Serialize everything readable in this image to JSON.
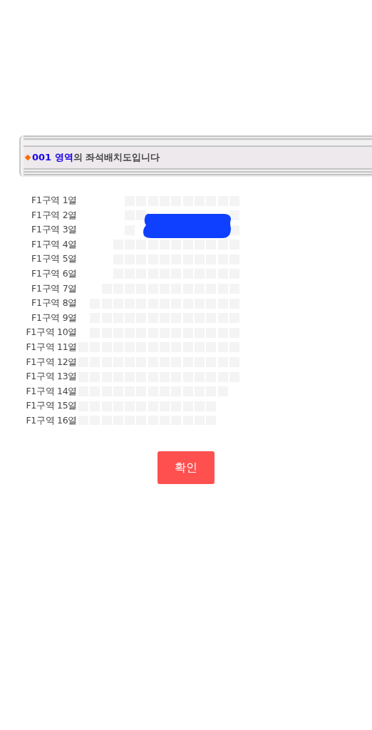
{
  "header": {
    "highlight": "001 영역",
    "title": "의 좌석배치도입니다"
  },
  "rows": [
    {
      "label": "F1구역 1열",
      "seats": [
        {
          "kind": "gap"
        },
        {
          "kind": "gap"
        },
        {
          "kind": "gap"
        },
        {
          "kind": "gap"
        },
        {
          "kind": "seat"
        },
        {
          "kind": "seat"
        },
        {
          "kind": "seat"
        },
        {
          "kind": "seat"
        },
        {
          "kind": "seat"
        },
        {
          "kind": "seat"
        },
        {
          "kind": "seat"
        },
        {
          "kind": "seat"
        },
        {
          "kind": "seat"
        },
        {
          "kind": "seat"
        }
      ]
    },
    {
      "label": "F1구역 2열",
      "seats": [
        {
          "kind": "gap"
        },
        {
          "kind": "gap"
        },
        {
          "kind": "gap"
        },
        {
          "kind": "gap"
        },
        {
          "kind": "seat"
        },
        {
          "kind": "seat"
        },
        {
          "kind": "covered"
        },
        {
          "kind": "covered"
        },
        {
          "kind": "covered"
        },
        {
          "kind": "covered"
        },
        {
          "kind": "covered"
        },
        {
          "kind": "covered"
        },
        {
          "kind": "covered"
        },
        {
          "kind": "seat"
        }
      ]
    },
    {
      "label": "F1구역 3열",
      "seats": [
        {
          "kind": "gap"
        },
        {
          "kind": "gap"
        },
        {
          "kind": "gap"
        },
        {
          "kind": "gap"
        },
        {
          "kind": "seat"
        },
        {
          "kind": "covered"
        },
        {
          "kind": "covered"
        },
        {
          "kind": "covered"
        },
        {
          "kind": "covered"
        },
        {
          "kind": "covered"
        },
        {
          "kind": "covered"
        },
        {
          "kind": "covered"
        },
        {
          "kind": "covered"
        },
        {
          "kind": "seat"
        }
      ]
    },
    {
      "label": "F1구역 4열",
      "seats": [
        {
          "kind": "gap"
        },
        {
          "kind": "gap"
        },
        {
          "kind": "gap"
        },
        {
          "kind": "seat"
        },
        {
          "kind": "seat"
        },
        {
          "kind": "seat"
        },
        {
          "kind": "seat"
        },
        {
          "kind": "seat"
        },
        {
          "kind": "seat"
        },
        {
          "kind": "seat"
        },
        {
          "kind": "seat"
        },
        {
          "kind": "seat"
        },
        {
          "kind": "seat"
        },
        {
          "kind": "seat"
        }
      ]
    },
    {
      "label": "F1구역 5열",
      "seats": [
        {
          "kind": "gap"
        },
        {
          "kind": "gap"
        },
        {
          "kind": "gap"
        },
        {
          "kind": "seat"
        },
        {
          "kind": "seat"
        },
        {
          "kind": "seat"
        },
        {
          "kind": "seat"
        },
        {
          "kind": "seat"
        },
        {
          "kind": "seat"
        },
        {
          "kind": "seat"
        },
        {
          "kind": "seat"
        },
        {
          "kind": "seat"
        },
        {
          "kind": "seat"
        },
        {
          "kind": "seat"
        }
      ]
    },
    {
      "label": "F1구역 6열",
      "seats": [
        {
          "kind": "gap"
        },
        {
          "kind": "gap"
        },
        {
          "kind": "gap"
        },
        {
          "kind": "seat"
        },
        {
          "kind": "seat"
        },
        {
          "kind": "seat"
        },
        {
          "kind": "seat"
        },
        {
          "kind": "seat"
        },
        {
          "kind": "seat"
        },
        {
          "kind": "seat"
        },
        {
          "kind": "seat"
        },
        {
          "kind": "seat"
        },
        {
          "kind": "seat"
        },
        {
          "kind": "seat"
        }
      ]
    },
    {
      "label": "F1구역 7열",
      "seats": [
        {
          "kind": "gap"
        },
        {
          "kind": "gap"
        },
        {
          "kind": "seat"
        },
        {
          "kind": "seat"
        },
        {
          "kind": "seat"
        },
        {
          "kind": "seat"
        },
        {
          "kind": "seat"
        },
        {
          "kind": "seat"
        },
        {
          "kind": "seat"
        },
        {
          "kind": "seat"
        },
        {
          "kind": "seat"
        },
        {
          "kind": "seat"
        },
        {
          "kind": "seat"
        },
        {
          "kind": "seat"
        }
      ]
    },
    {
      "label": "F1구역 8열",
      "seats": [
        {
          "kind": "gap"
        },
        {
          "kind": "seat"
        },
        {
          "kind": "seat"
        },
        {
          "kind": "seat"
        },
        {
          "kind": "seat"
        },
        {
          "kind": "seat"
        },
        {
          "kind": "seat"
        },
        {
          "kind": "seat"
        },
        {
          "kind": "seat"
        },
        {
          "kind": "seat"
        },
        {
          "kind": "seat"
        },
        {
          "kind": "seat"
        },
        {
          "kind": "seat"
        },
        {
          "kind": "seat"
        }
      ]
    },
    {
      "label": "F1구역 9열",
      "seats": [
        {
          "kind": "gap"
        },
        {
          "kind": "seat"
        },
        {
          "kind": "seat"
        },
        {
          "kind": "seat"
        },
        {
          "kind": "seat"
        },
        {
          "kind": "seat"
        },
        {
          "kind": "seat"
        },
        {
          "kind": "seat"
        },
        {
          "kind": "seat"
        },
        {
          "kind": "seat"
        },
        {
          "kind": "seat"
        },
        {
          "kind": "seat"
        },
        {
          "kind": "seat"
        },
        {
          "kind": "seat"
        }
      ]
    },
    {
      "label": "F1구역 10열",
      "seats": [
        {
          "kind": "gap"
        },
        {
          "kind": "seat"
        },
        {
          "kind": "seat"
        },
        {
          "kind": "seat"
        },
        {
          "kind": "seat"
        },
        {
          "kind": "seat"
        },
        {
          "kind": "seat"
        },
        {
          "kind": "seat"
        },
        {
          "kind": "seat"
        },
        {
          "kind": "seat"
        },
        {
          "kind": "seat"
        },
        {
          "kind": "seat"
        },
        {
          "kind": "seat"
        },
        {
          "kind": "seat"
        }
      ]
    },
    {
      "label": "F1구역 11열",
      "seats": [
        {
          "kind": "seat"
        },
        {
          "kind": "seat"
        },
        {
          "kind": "seat"
        },
        {
          "kind": "seat"
        },
        {
          "kind": "seat"
        },
        {
          "kind": "seat"
        },
        {
          "kind": "seat"
        },
        {
          "kind": "seat"
        },
        {
          "kind": "seat"
        },
        {
          "kind": "seat"
        },
        {
          "kind": "seat"
        },
        {
          "kind": "seat"
        },
        {
          "kind": "seat"
        },
        {
          "kind": "seat"
        }
      ]
    },
    {
      "label": "F1구역 12열",
      "seats": [
        {
          "kind": "seat"
        },
        {
          "kind": "seat"
        },
        {
          "kind": "seat"
        },
        {
          "kind": "seat"
        },
        {
          "kind": "seat"
        },
        {
          "kind": "seat"
        },
        {
          "kind": "seat"
        },
        {
          "kind": "seat"
        },
        {
          "kind": "seat"
        },
        {
          "kind": "seat"
        },
        {
          "kind": "seat"
        },
        {
          "kind": "seat"
        },
        {
          "kind": "seat"
        },
        {
          "kind": "seat"
        }
      ]
    },
    {
      "label": "F1구역 13열",
      "seats": [
        {
          "kind": "seat"
        },
        {
          "kind": "seat"
        },
        {
          "kind": "seat"
        },
        {
          "kind": "seat"
        },
        {
          "kind": "seat"
        },
        {
          "kind": "seat"
        },
        {
          "kind": "seat"
        },
        {
          "kind": "seat"
        },
        {
          "kind": "seat"
        },
        {
          "kind": "seat"
        },
        {
          "kind": "seat"
        },
        {
          "kind": "seat"
        },
        {
          "kind": "seat"
        },
        {
          "kind": "seat"
        }
      ]
    },
    {
      "label": "F1구역 14열",
      "seats": [
        {
          "kind": "seat"
        },
        {
          "kind": "seat"
        },
        {
          "kind": "seat"
        },
        {
          "kind": "seat"
        },
        {
          "kind": "seat"
        },
        {
          "kind": "seat"
        },
        {
          "kind": "seat"
        },
        {
          "kind": "seat"
        },
        {
          "kind": "seat"
        },
        {
          "kind": "seat"
        },
        {
          "kind": "seat"
        },
        {
          "kind": "seat"
        },
        {
          "kind": "seat"
        },
        {
          "kind": "gap"
        }
      ]
    },
    {
      "label": "F1구역 15열",
      "seats": [
        {
          "kind": "seat"
        },
        {
          "kind": "seat"
        },
        {
          "kind": "seat"
        },
        {
          "kind": "seat"
        },
        {
          "kind": "seat"
        },
        {
          "kind": "seat"
        },
        {
          "kind": "seat"
        },
        {
          "kind": "seat"
        },
        {
          "kind": "seat"
        },
        {
          "kind": "seat"
        },
        {
          "kind": "seat"
        },
        {
          "kind": "seat"
        },
        {
          "kind": "gap"
        },
        {
          "kind": "gap"
        }
      ]
    },
    {
      "label": "F1구역 16열",
      "seats": [
        {
          "kind": "seat"
        },
        {
          "kind": "seat"
        },
        {
          "kind": "seat"
        },
        {
          "kind": "seat"
        },
        {
          "kind": "seat"
        },
        {
          "kind": "seat"
        },
        {
          "kind": "seat"
        },
        {
          "kind": "seat"
        },
        {
          "kind": "seat"
        },
        {
          "kind": "seat"
        },
        {
          "kind": "seat"
        },
        {
          "kind": "seat"
        },
        {
          "kind": "gap"
        },
        {
          "kind": "gap"
        }
      ]
    }
  ],
  "button": "확인"
}
